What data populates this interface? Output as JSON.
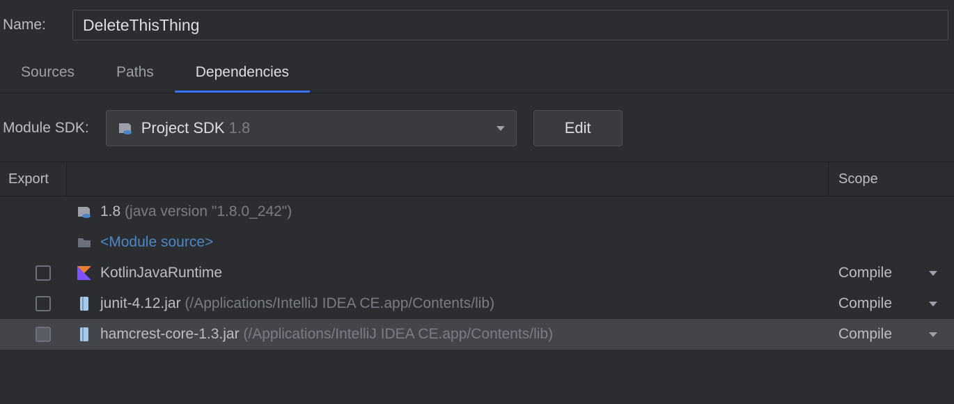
{
  "name_label": "Name:",
  "name_value": "DeleteThisThing",
  "tabs": {
    "sources": "Sources",
    "paths": "Paths",
    "dependencies": "Dependencies"
  },
  "sdk": {
    "label": "Module SDK:",
    "selected_prefix": "Project SDK ",
    "selected_version": "1.8",
    "edit": "Edit"
  },
  "columns": {
    "export": "Export",
    "scope": "Scope"
  },
  "rows": {
    "jdk": {
      "name": "1.8",
      "detail": " (java version \"1.8.0_242\")"
    },
    "module_source": "<Module source>",
    "kotlin": {
      "name": "KotlinJavaRuntime",
      "scope": "Compile"
    },
    "junit": {
      "name": "junit-4.12.jar",
      "path": " (/Applications/IntelliJ IDEA CE.app/Contents/lib)",
      "scope": "Compile"
    },
    "hamcrest": {
      "name": "hamcrest-core-1.3.jar",
      "path": " (/Applications/IntelliJ IDEA CE.app/Contents/lib)",
      "scope": "Compile"
    }
  }
}
